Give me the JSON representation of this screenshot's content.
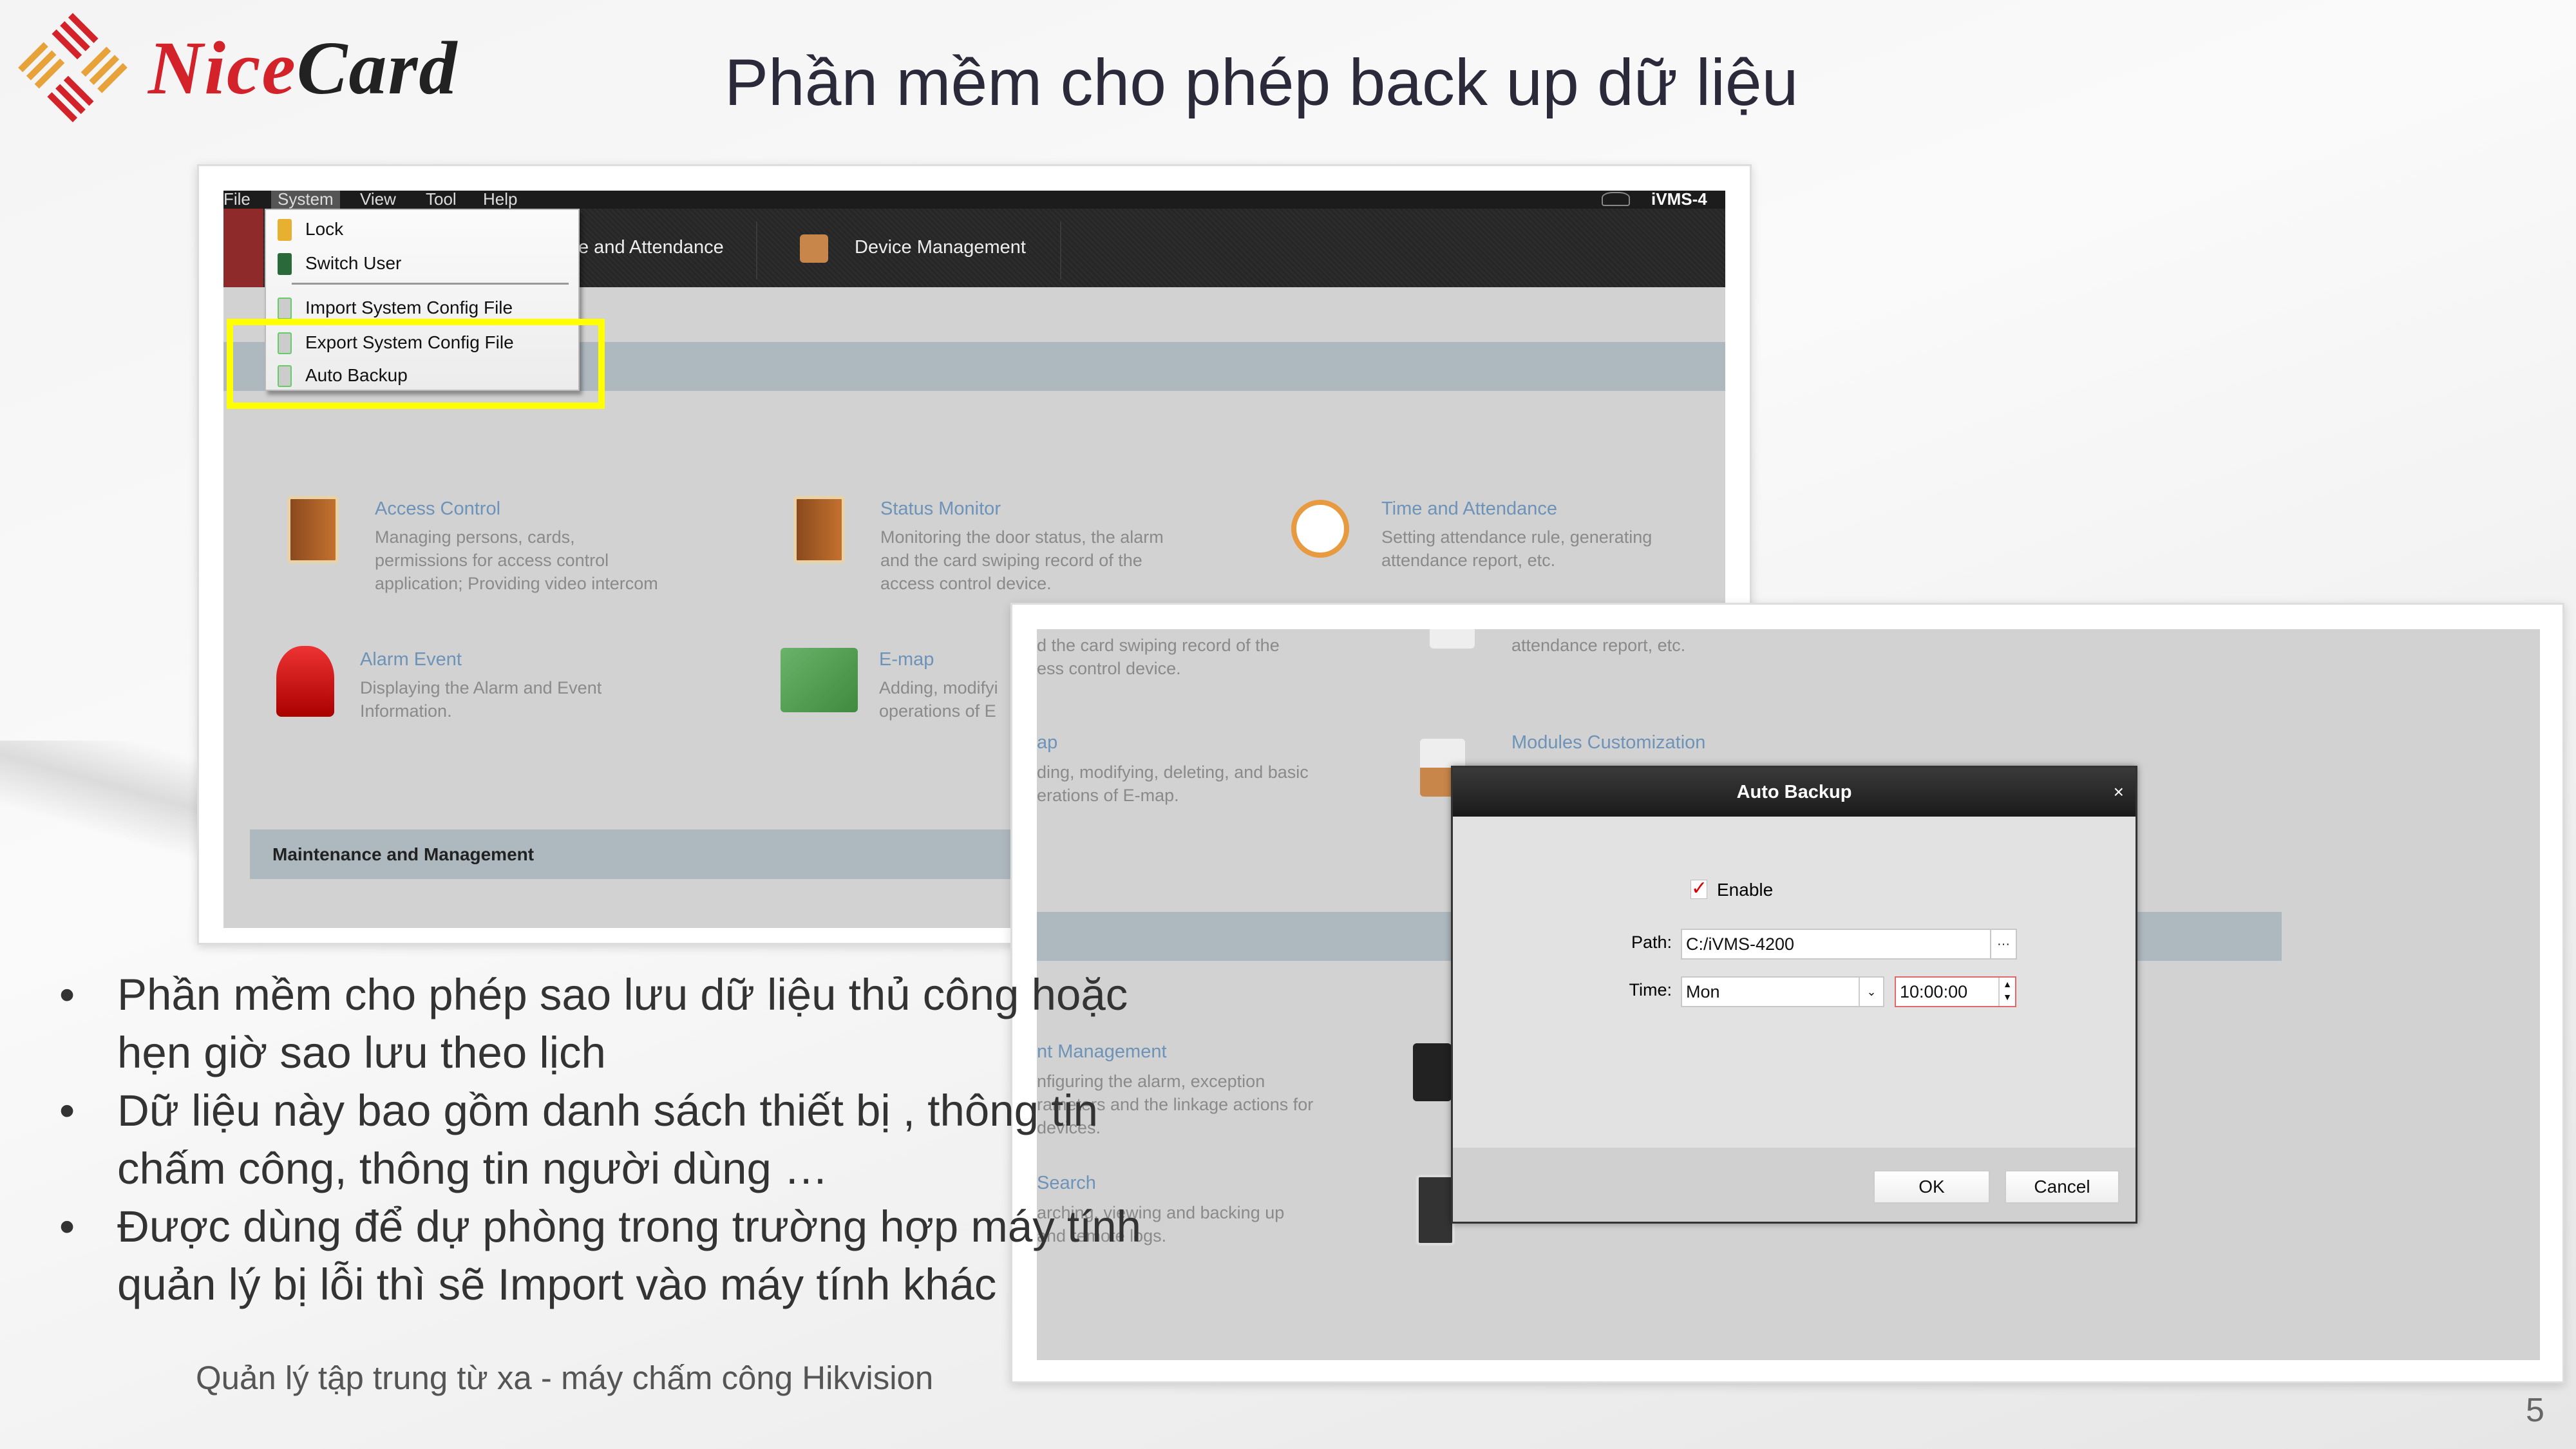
{
  "brand": {
    "part1": "Nice",
    "part2": "Card",
    "accent": "#d3222a"
  },
  "slide_title": "Phần mềm cho phép back up dữ liệu",
  "app1": {
    "menubar": [
      "File",
      "System",
      "View",
      "Tool",
      "Help"
    ],
    "app_name": "iVMS-4",
    "toolbar": [
      "e and Attendance",
      "Device Management"
    ],
    "system_menu": [
      "Lock",
      "Switch User",
      "Import System Config File",
      "Export System Config File",
      "Auto Backup"
    ],
    "modules": [
      {
        "title": "Access Control",
        "desc": [
          "Managing persons, cards,",
          "permissions for access control",
          "application; Providing video intercom"
        ]
      },
      {
        "title": "Status Monitor",
        "desc": [
          "Monitoring the door status, the alarm",
          "and the card swiping record of the",
          "access control device."
        ]
      },
      {
        "title": "Time and Attendance",
        "desc": [
          "Setting attendance rule, generating",
          "attendance report, etc."
        ]
      },
      {
        "title": "Alarm Event",
        "desc": [
          "Displaying the Alarm and Event",
          "Information."
        ]
      },
      {
        "title": "E-map",
        "desc": [
          "Adding, modifyi",
          "operations of E"
        ]
      }
    ],
    "section": "Maintenance and Management",
    "highlight_color": "#ffff00"
  },
  "app2": {
    "fragments": {
      "status_lines": [
        "d the card swiping record of the",
        "ess control device."
      ],
      "attendance_line": "attendance report, etc.",
      "emap_title": "ap",
      "emap_lines": [
        "ding, modifying, deleting, and basic",
        "erations of E-map."
      ],
      "modules_custom": "Modules Customization",
      "event_title": "nt Management",
      "event_lines": [
        "nfiguring the alarm, exception",
        "rameters and the linkage actions for",
        "devices."
      ],
      "search_title": "Search",
      "search_lines": [
        "arching, viewing and backing up",
        "and remote logs."
      ]
    },
    "dialog": {
      "title": "Auto Backup",
      "close": "×",
      "enable_label": "Enable",
      "enabled": true,
      "path_label": "Path:",
      "path_value": "C:/iVMS-4200",
      "browse": "···",
      "time_label": "Time:",
      "day_value": "Mon",
      "time_value": "10:00:00",
      "ok": "OK",
      "cancel": "Cancel"
    }
  },
  "bullets": [
    "Phần mềm cho phép sao lưu dữ liệu thủ công hoặc hẹn giờ sao lưu theo lịch",
    "Dữ liệu này bao gồm danh sách thiết bị , thông tin chấm công, thông tin người dùng …",
    "Được dùng để dự phòng trong trường hợp máy tính quản lý bị lỗi thì sẽ Import vào máy tính khác"
  ],
  "bullet_char": "•",
  "footer": "Quản lý tập trung từ xa - máy chấm công Hikvision",
  "page_number": "5"
}
